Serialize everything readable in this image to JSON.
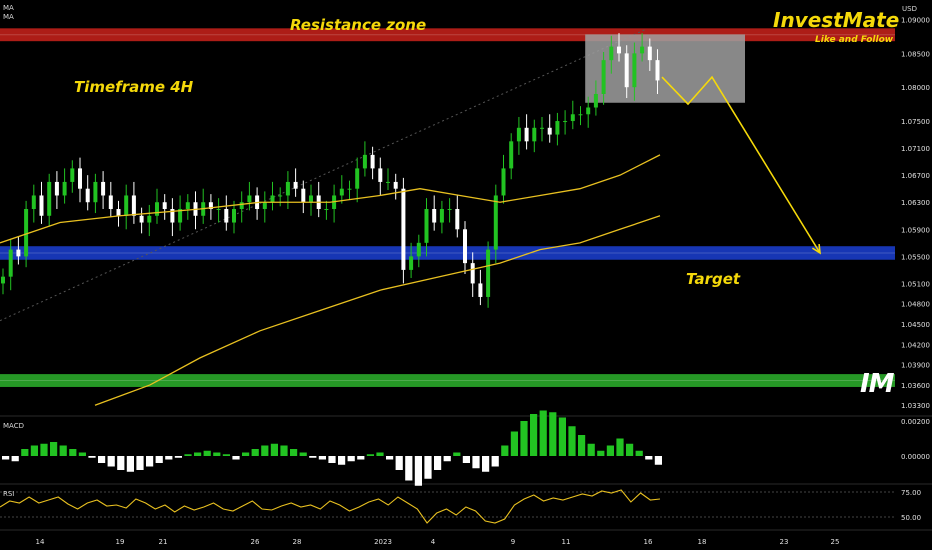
{
  "header": {
    "ma_labels": [
      "MA",
      "MA"
    ],
    "currency": "USD"
  },
  "annotations": {
    "resistance_zone": "Resistance zone",
    "timeframe": "Timeframe 4H",
    "target": "Target",
    "brand": "InvestMate",
    "brand_sub": "Like and Follow",
    "logo": "IM"
  },
  "indicators": {
    "macd_label": "MACD",
    "rsi_label": "RSI"
  },
  "colors": {
    "background": "#000000",
    "up_candle": "#22c322",
    "down_candle": "#ffffff",
    "ma": "#e8c020",
    "resistance": "#c0201a",
    "target": "#1a3cc8",
    "support": "#2aa82a",
    "annotation_text": "#f5d90a",
    "projection": "#f5d90a",
    "box": "#a0a0a0"
  },
  "chart_data": [
    {
      "type": "candlestick",
      "title": "",
      "price_axis": {
        "unit": "USD",
        "ticks": [
          "1.09000",
          "1.08500",
          "1.08000",
          "1.07500",
          "1.07100",
          "1.06700",
          "1.06300",
          "1.05900",
          "1.05500",
          "1.05100",
          "1.04800",
          "1.04500",
          "1.04200",
          "1.03900",
          "1.03600",
          "1.03300"
        ]
      },
      "x_axis": {
        "ticks": [
          "14",
          "19",
          "21",
          "26",
          "28",
          "2023",
          "4",
          "9",
          "11",
          "16",
          "18",
          "23",
          "25"
        ]
      },
      "ylim": [
        1.032,
        1.092
      ],
      "zones": [
        {
          "name": "Resistance zone",
          "from": 1.0868,
          "to": 1.0887
        },
        {
          "name": "Target",
          "from": 1.0545,
          "to": 1.0565
        },
        {
          "name": "support",
          "from": 1.0357,
          "to": 1.0376
        }
      ],
      "candle_closes": [
        1.052,
        1.056,
        1.055,
        1.062,
        1.064,
        1.061,
        1.066,
        1.064,
        1.066,
        1.068,
        1.065,
        1.063,
        1.066,
        1.064,
        1.062,
        1.061,
        1.064,
        1.061,
        1.06,
        1.061,
        1.063,
        1.062,
        1.06,
        1.062,
        1.063,
        1.061,
        1.063,
        1.062,
        1.062,
        1.06,
        1.062,
        1.063,
        1.064,
        1.062,
        1.063,
        1.064,
        1.064,
        1.066,
        1.065,
        1.063,
        1.064,
        1.062,
        1.062,
        1.064,
        1.065,
        1.065,
        1.068,
        1.07,
        1.068,
        1.066,
        1.066,
        1.065,
        1.053,
        1.055,
        1.057,
        1.062,
        1.06,
        1.062,
        1.062,
        1.059,
        1.054,
        1.051,
        1.049,
        1.056,
        1.064,
        1.068,
        1.072,
        1.074,
        1.072,
        1.074,
        1.074,
        1.073,
        1.075,
        1.075,
        1.076,
        1.076,
        1.077,
        1.079,
        1.084,
        1.086,
        1.085,
        1.08,
        1.085,
        1.086,
        1.084,
        1.081
      ],
      "ma_fast_points": [
        [
          0,
          1.057
        ],
        [
          60,
          1.06
        ],
        [
          120,
          1.061
        ],
        [
          200,
          1.062
        ],
        [
          260,
          1.063
        ],
        [
          330,
          1.063
        ],
        [
          380,
          1.064
        ],
        [
          420,
          1.065
        ],
        [
          460,
          1.064
        ],
        [
          500,
          1.063
        ],
        [
          540,
          1.064
        ],
        [
          580,
          1.065
        ],
        [
          620,
          1.067
        ],
        [
          660,
          1.07
        ]
      ],
      "ma_slow_points": [
        [
          95,
          1.033
        ],
        [
          150,
          1.036
        ],
        [
          200,
          1.04
        ],
        [
          260,
          1.044
        ],
        [
          320,
          1.047
        ],
        [
          380,
          1.05
        ],
        [
          440,
          1.052
        ],
        [
          500,
          1.054
        ],
        [
          540,
          1.056
        ],
        [
          580,
          1.057
        ],
        [
          620,
          1.059
        ],
        [
          660,
          1.061
        ]
      ],
      "projection": [
        [
          662,
          1.0815
        ],
        [
          688,
          1.0775
        ],
        [
          712,
          1.0815
        ],
        [
          820,
          1.0555
        ]
      ],
      "consolidation_box": {
        "from": 1.0777,
        "to": 1.0878
      }
    },
    {
      "type": "bar",
      "name": "MACD",
      "axis_ticks": [
        "0.00200",
        "0.00000"
      ],
      "values": [
        -0.0002,
        -0.0003,
        0.0004,
        0.0006,
        0.0007,
        0.0008,
        0.0006,
        0.0004,
        0.0002,
        -0.0001,
        -0.0004,
        -0.0006,
        -0.0008,
        -0.0009,
        -0.0008,
        -0.0006,
        -0.0004,
        -0.0002,
        -0.0001,
        0.0001,
        0.0002,
        0.0003,
        0.0002,
        0.0001,
        -0.0002,
        0.0002,
        0.0004,
        0.0006,
        0.0007,
        0.0006,
        0.0004,
        0.0002,
        -0.0001,
        -0.0002,
        -0.0004,
        -0.0005,
        -0.0003,
        -0.0002,
        0.0001,
        0.0002,
        -0.0002,
        -0.0008,
        -0.0014,
        -0.0017,
        -0.0013,
        -0.0008,
        -0.0003,
        0.0002,
        -0.0004,
        -0.0007,
        -0.0009,
        -0.0006,
        0.0006,
        0.0014,
        0.002,
        0.0024,
        0.0026,
        0.0025,
        0.0022,
        0.0017,
        0.0012,
        0.0007,
        0.0003,
        0.0006,
        0.001,
        0.0007,
        0.0003,
        -0.0002,
        -0.0005
      ]
    },
    {
      "type": "line",
      "name": "RSI",
      "axis_ticks": [
        "75.00",
        "50.00"
      ],
      "ylim": [
        40,
        80
      ],
      "values": [
        60,
        66,
        64,
        70,
        64,
        67,
        70,
        63,
        58,
        64,
        67,
        61,
        62,
        59,
        68,
        64,
        58,
        62,
        55,
        61,
        57,
        60,
        64,
        58,
        56,
        61,
        66,
        58,
        57,
        61,
        64,
        60,
        62,
        58,
        66,
        62,
        56,
        60,
        65,
        68,
        62,
        70,
        64,
        58,
        44,
        54,
        58,
        52,
        60,
        56,
        46,
        44,
        48,
        62,
        68,
        72,
        66,
        69,
        67,
        70,
        73,
        71,
        76,
        74,
        77,
        65,
        74,
        67,
        68
      ]
    }
  ]
}
